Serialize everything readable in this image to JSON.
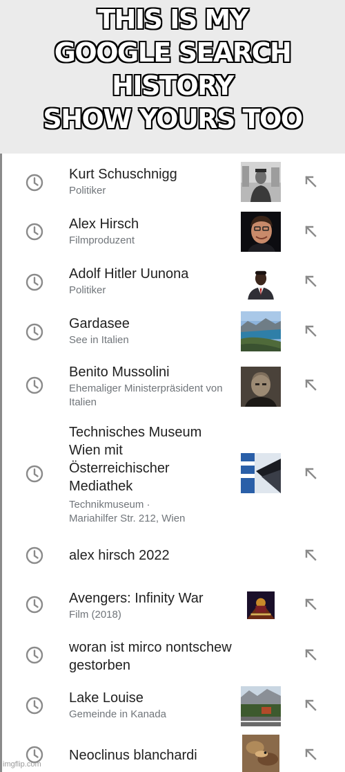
{
  "meme": {
    "caption_lines": [
      "THIS IS MY",
      "GOOGLE SEARCH HISTORY",
      "SHOW YOURS TOO"
    ]
  },
  "history": {
    "items": [
      {
        "title": "Kurt Schuschnigg",
        "subtitle": "Politiker",
        "thumbnail": "portrait-photo"
      },
      {
        "title": "Alex Hirsch",
        "subtitle": "Filmproduzent",
        "thumbnail": "portrait-photo"
      },
      {
        "title": "Adolf Hitler Uunona",
        "subtitle": "Politiker",
        "thumbnail": "portrait-photo"
      },
      {
        "title": "Gardasee",
        "subtitle": "See in Italien",
        "thumbnail": "lake-photo"
      },
      {
        "title": "Benito Mussolini",
        "subtitle": "Ehemaliger Ministerpräsident von Italien",
        "thumbnail": "portrait-photo"
      },
      {
        "title": "Technisches Museum Wien mit Österreichischer Mediathek",
        "subtitle": "Technikmuseum · Mariahilfer Str. 212, Wien",
        "thumbnail": "museum-photo"
      },
      {
        "title": "alex hirsch 2022",
        "subtitle": "",
        "thumbnail": ""
      },
      {
        "title": "Avengers: Infinity War",
        "subtitle": "Film (2018)",
        "thumbnail": "movie-poster"
      },
      {
        "title": "woran ist mirco nontschew gestorben",
        "subtitle": "",
        "thumbnail": ""
      },
      {
        "title": "Lake Louise",
        "subtitle": "Gemeinde in Kanada",
        "thumbnail": "town-photo"
      },
      {
        "title": "Neoclinus blanchardi",
        "subtitle": "",
        "thumbnail": "fish-photo"
      }
    ]
  },
  "icons": {
    "history": "history-clock-icon",
    "insert": "arrow-up-left-icon"
  },
  "colors": {
    "text_primary": "#212121",
    "text_secondary": "#70757a",
    "icon": "#8a8a8a",
    "caption_band": "#ebebeb"
  },
  "watermark": "imgflip.com"
}
